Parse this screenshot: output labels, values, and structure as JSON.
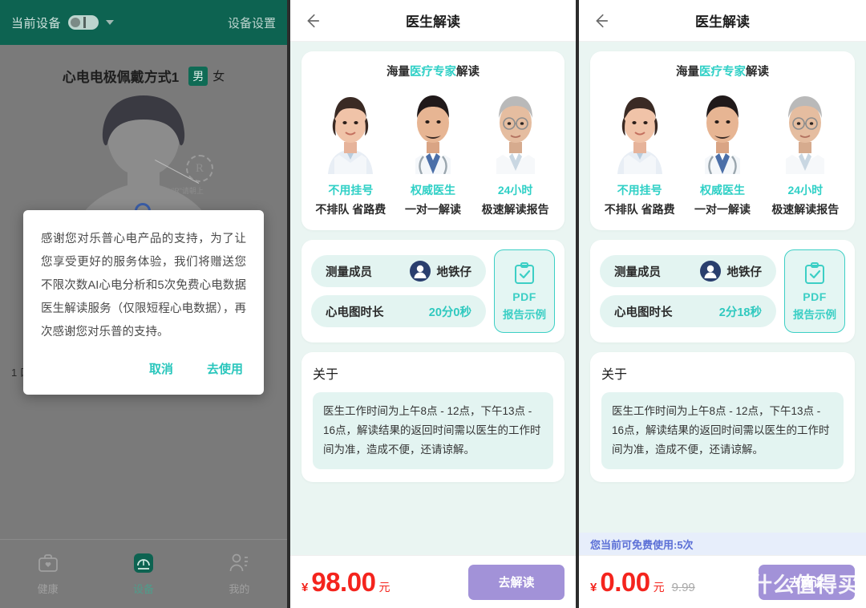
{
  "colors": {
    "header_green": "#0d6351",
    "teal": "#2fd0c6",
    "mint_bg": "#eaf5f2",
    "price_red": "#f4241d",
    "purple_button": "#a292d8",
    "banner_blue": "#5b6fd6"
  },
  "panel1": {
    "header": {
      "device_label": "当前设备",
      "device_pill_icon": "device-pill-icon",
      "dropdown_icon": "chevron-down-icon",
      "settings_label": "设备设置"
    },
    "title": "心电电极佩戴方式1",
    "gender": {
      "male": "男",
      "female": "女",
      "selected": "男"
    },
    "diagram": {
      "marker_letter": "R",
      "marker_caption": "\"R\"请朝上",
      "torso_icon": "torso-illustration",
      "electrode_icon": "electrode-marker-icon"
    },
    "obscured_fragment": "1\n口",
    "dialog": {
      "message": "感谢您对乐普心电产品的支持，为了让您享受更好的服务体验，我们将赠送您不限次数AI心电分析和5次免费心电数据医生解读服务（仅限短程心电数据），再次感谢您对乐普的支持。",
      "cancel_label": "取消",
      "confirm_label": "去使用"
    },
    "tabbar": [
      {
        "label": "健康",
        "icon": "health-bag-icon",
        "active": false
      },
      {
        "label": "设备",
        "icon": "device-icon",
        "active": true
      },
      {
        "label": "我的",
        "icon": "profile-icon",
        "active": false
      }
    ]
  },
  "panel2": {
    "nav": {
      "back_icon": "back-arrow-icon",
      "title": "医生解读"
    },
    "promo": {
      "heading_prefix": "海量",
      "heading_highlight": "医疗专家",
      "heading_suffix": "解读",
      "doctors": [
        {
          "photo_icon": "female-doctor-photo",
          "title": "不用挂号",
          "subtitle": "不排队 省路费"
        },
        {
          "photo_icon": "male-doctor-photo",
          "title": "权威医生",
          "subtitle": "一对一解读"
        },
        {
          "photo_icon": "senior-doctor-photo",
          "title": "24小时",
          "subtitle": "极速解读报告"
        }
      ]
    },
    "info": {
      "member_label": "测量成员",
      "member_avatar_icon": "user-avatar-icon",
      "member_value": "地铁仔",
      "duration_label": "心电图时长",
      "duration_value": "20分0秒",
      "pdf_icon": "clipboard-check-icon",
      "pdf_line1": "PDF",
      "pdf_line2": "报告示例"
    },
    "about": {
      "title": "关于",
      "body": "医生工作时间为上午8点 - 12点，下午13点 - 16点，解读结果的返回时间需以医生的工作时间为准，造成不便，还请谅解。"
    },
    "paybar": {
      "currency": "¥",
      "price": "98.00",
      "unit": "元",
      "old_price": "",
      "button_label": "去解读"
    },
    "free_banner": ""
  },
  "panel3": {
    "nav": {
      "back_icon": "back-arrow-icon",
      "title": "医生解读"
    },
    "promo": {
      "heading_prefix": "海量",
      "heading_highlight": "医疗专家",
      "heading_suffix": "解读",
      "doctors": [
        {
          "photo_icon": "female-doctor-photo",
          "title": "不用挂号",
          "subtitle": "不排队 省路费"
        },
        {
          "photo_icon": "male-doctor-photo",
          "title": "权威医生",
          "subtitle": "一对一解读"
        },
        {
          "photo_icon": "senior-doctor-photo",
          "title": "24小时",
          "subtitle": "极速解读报告"
        }
      ]
    },
    "info": {
      "member_label": "测量成员",
      "member_avatar_icon": "user-avatar-icon",
      "member_value": "地铁仔",
      "duration_label": "心电图时长",
      "duration_value": "2分18秒",
      "pdf_icon": "clipboard-check-icon",
      "pdf_line1": "PDF",
      "pdf_line2": "报告示例"
    },
    "about": {
      "title": "关于",
      "body": "医生工作时间为上午8点 - 12点，下午13点 - 16点，解读结果的返回时间需以医生的工作时间为准，造成不便，还请谅解。"
    },
    "paybar": {
      "currency": "¥",
      "price": "0.00",
      "unit": "元",
      "old_price": "9.99",
      "button_label": "去解读"
    },
    "free_banner": "您当前可免费使用:5次"
  },
  "watermark": {
    "mark": "值",
    "text": "什么值得买"
  }
}
